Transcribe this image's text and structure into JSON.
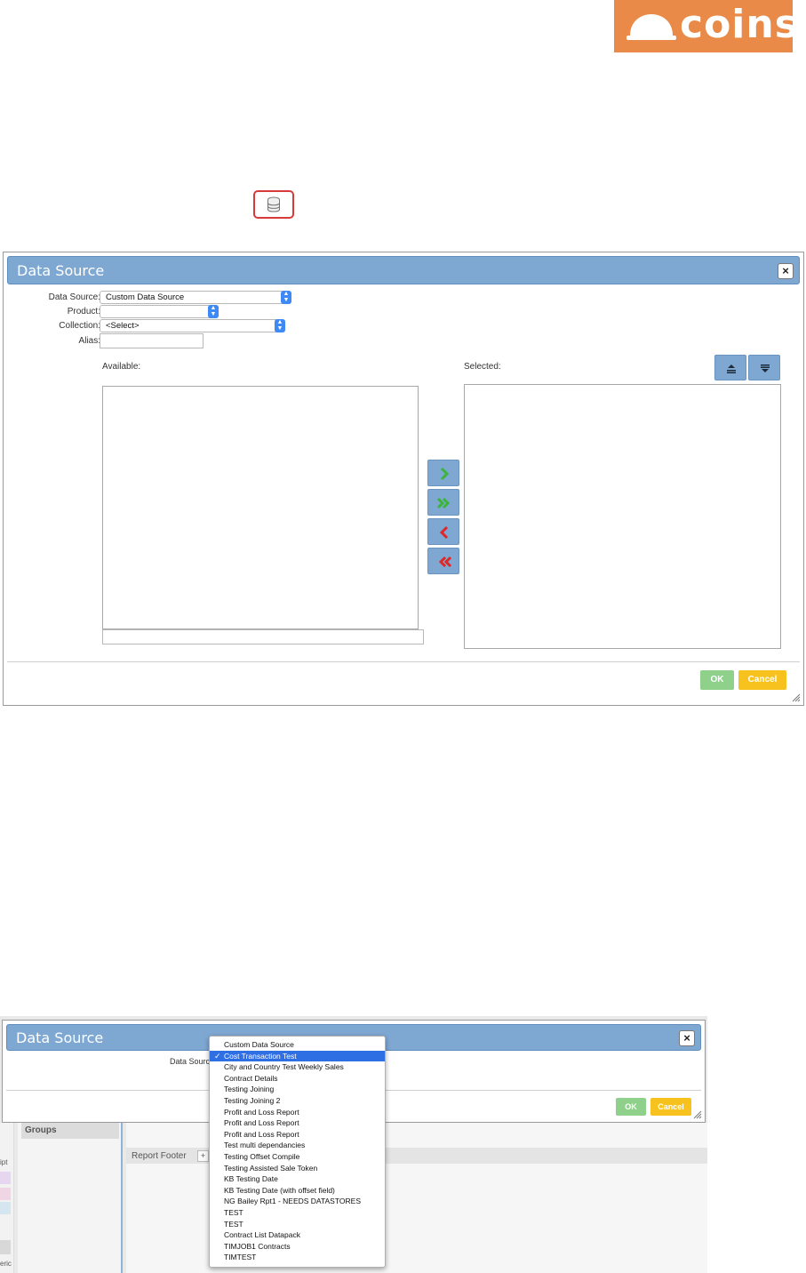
{
  "logo": {
    "text": "coins"
  },
  "dialog1": {
    "title": "Data Source",
    "fields": {
      "data_source_label": "Data Source:",
      "data_source_value": "Custom Data Source",
      "product_label": "Product:",
      "product_value": "",
      "collection_label": "Collection:",
      "collection_value": "<Select>",
      "alias_label": "Alias:",
      "alias_value": ""
    },
    "available_label": "Available:",
    "selected_label": "Selected:",
    "ok_label": "OK",
    "cancel_label": "Cancel"
  },
  "dialog2": {
    "title": "Data Source",
    "data_source_label": "Data Sourc",
    "ok_label": "OK",
    "cancel_label": "Cancel",
    "background": {
      "groups_label": "Groups",
      "report_footer_label": "Report Footer",
      "plus_label": "+",
      "side_label_1": "ipt",
      "side_label_2": "eric"
    },
    "options": [
      "Custom Data Source",
      "Cost Transaction Test",
      "City and Country Test Weekly Sales",
      "Contract Details",
      "Testing Joining",
      "Testing Joining 2",
      "Profit and Loss Report",
      "Profit and Loss Report",
      "Profit and Loss Report",
      "Test multi dependancies",
      "Testing Offset Compile",
      "Testing Assisted Sale Token",
      "KB Testing Date",
      "KB Testing Date (with offset field)",
      "NG Bailey Rpt1 - NEEDS DATASTORES",
      "TEST",
      "TEST",
      "Contract List Datapack",
      "TIMJOB1 Contracts",
      "TIMTEST"
    ],
    "selected_option": "Cost Transaction Test",
    "check_glyph": "✓"
  },
  "colors": {
    "brand": "#e98a48",
    "dialog_header": "#7ea8d2",
    "ok": "#8fd08a",
    "cancel": "#f7c21d",
    "arrow_add": "#3cb43c",
    "arrow_remove": "#e02626",
    "highlight": "#2f6fe4"
  }
}
